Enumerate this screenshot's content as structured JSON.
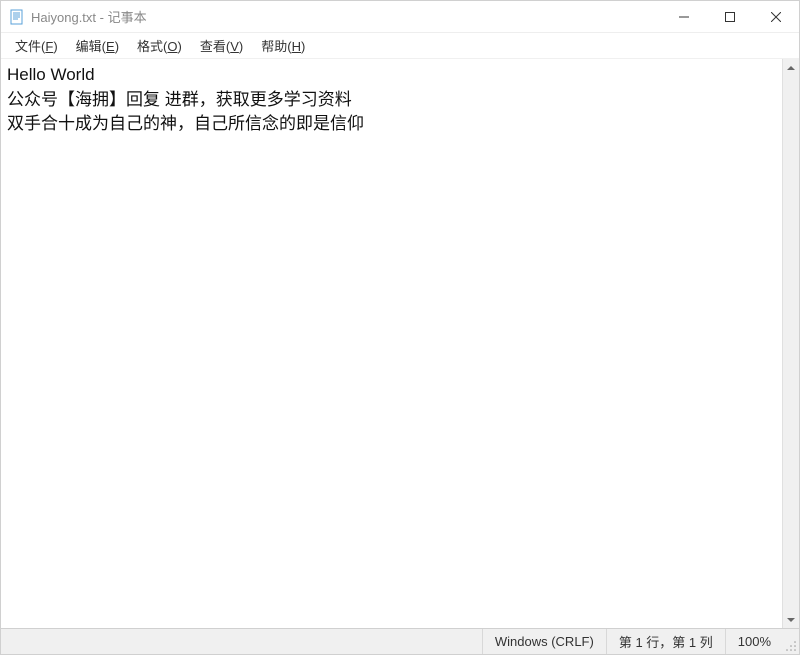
{
  "titlebar": {
    "title": "Haiyong.txt - 记事本"
  },
  "menubar": {
    "items": [
      {
        "label": "文件",
        "hotkey": "F"
      },
      {
        "label": "编辑",
        "hotkey": "E"
      },
      {
        "label": "格式",
        "hotkey": "O"
      },
      {
        "label": "查看",
        "hotkey": "V"
      },
      {
        "label": "帮助",
        "hotkey": "H"
      }
    ]
  },
  "content": {
    "text": "Hello World\n公众号【海拥】回复 进群，获取更多学习资料\n双手合十成为自己的神，自己所信念的即是信仰"
  },
  "statusbar": {
    "line_ending": "Windows (CRLF)",
    "cursor": "第 1 行，第 1 列",
    "zoom": "100%"
  }
}
